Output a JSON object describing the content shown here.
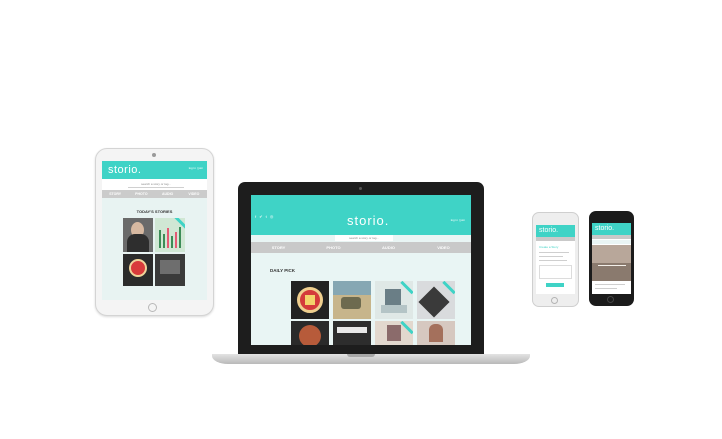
{
  "brand": {
    "logo": "storio.",
    "accent": "#3fd3c6"
  },
  "search": {
    "placeholder": "search a story or tag..."
  },
  "nav": [
    "STORY",
    "PHOTO",
    "AUDIO",
    "VIDEO"
  ],
  "header": {
    "login": "log in | join",
    "social": "f ✔ t ◎"
  },
  "tablet": {
    "section_title": "TODAY'S STORIES"
  },
  "laptop": {
    "section_title": "DAILY PICK"
  },
  "phone": {
    "section_title": "Create a Story"
  }
}
